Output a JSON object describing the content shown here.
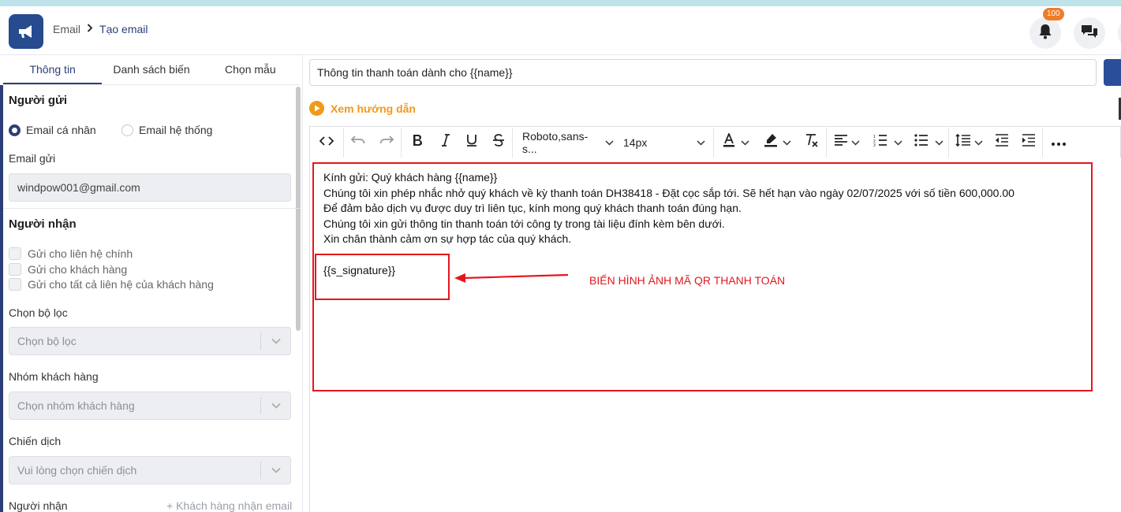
{
  "header": {
    "breadcrumb_root": "Email",
    "breadcrumb_current": "Tạo email",
    "notification_count": "100"
  },
  "left_panel": {
    "tabs": [
      {
        "label": "Thông tin",
        "active": true
      },
      {
        "label": "Danh sách biến",
        "active": false
      },
      {
        "label": "Chọn mẫu",
        "active": false
      }
    ],
    "sender": {
      "title": "Người gửi",
      "radio_personal": "Email cá nhân",
      "radio_system": "Email hệ thống",
      "selected": "Email cá nhân",
      "email_label": "Email gửi",
      "email_value": "windpow001@gmail.com"
    },
    "recipient": {
      "title": "Người nhận",
      "checkboxes": [
        "Gửi cho liên hệ chính",
        "Gửi cho khách hàng",
        "Gửi cho tất cả liên hệ của khách hàng"
      ],
      "filter_label": "Chọn bộ lọc",
      "filter_placeholder": "Chọn bộ lọc",
      "group_label": "Nhóm khách hàng",
      "group_placeholder": "Chọn nhóm khách hàng",
      "campaign_label": "Chiến dịch",
      "campaign_placeholder": "Vui lòng chọn chiến dịch",
      "recipients_label": "Người nhận",
      "add_recipient_link": "+ Khách hàng nhận email"
    }
  },
  "editor": {
    "subject": "Thông tin thanh toán dành cho {{name}}",
    "guide_link": "Xem hướng dẫn",
    "font_family": "Roboto,sans-s...",
    "font_size": "14px",
    "body_lines": [
      "Kính gửi: Quý khách hàng {{name}}",
      "Chúng tôi xin phép nhắc nhở quý khách về kỳ thanh toán DH38418 - Đặt cọc sắp tới. Sẽ hết hạn vào ngày 02/07/2025 với số tiền 600,000.00",
      "Để đảm bảo dịch vụ được duy trì liên tục, kính mong quý khách thanh toán đúng hạn.",
      "Chúng tôi xin gửi thông tin thanh toán tới công ty trong tài liệu đính kèm bên dưới.",
      "Xin chân thành cảm ơn sự hợp tác của quý khách."
    ],
    "signature_var": "{{s_signature}}",
    "annotation": "BIẾN HÌNH ẢNH MÃ QR THANH TOÁN"
  },
  "colors": {
    "brand": "#264b8e",
    "accent_orange": "#f09a1a",
    "annotation_red": "#e5161b",
    "tab_active": "#2c3e77"
  }
}
